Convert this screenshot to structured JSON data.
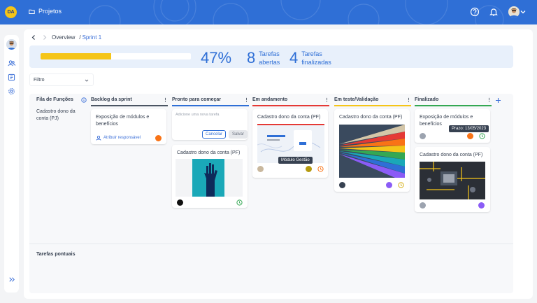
{
  "topbar": {
    "logo_text": "DA",
    "section_label": "Projetos",
    "icons": [
      "help-circle-icon",
      "bell-icon",
      "user-avatar",
      "chevron-down-icon"
    ]
  },
  "breadcrumb": {
    "root": "Overview",
    "separator": "/",
    "current": "Sprint 1"
  },
  "stats": {
    "progress": 0.47,
    "percent_label": "47%",
    "open_count": "8",
    "open_label_1": "Tarefas",
    "open_label_2": "abertas",
    "done_count": "4",
    "done_label_1": "Tarefas",
    "done_label_2": "finalizadas"
  },
  "filter": {
    "label": "Filtro"
  },
  "rows": {
    "queue_title": "Fila de Funções",
    "row1_label": "Cadastro dono da conta (PJ)",
    "row2_label": "Tarefas pontuais"
  },
  "columns": [
    {
      "title": "Backlog da sprint",
      "color": "#4b5563"
    },
    {
      "title": "Pronto para começar",
      "color": "#2f6fd6"
    },
    {
      "title": "Em andamento",
      "color": "#e53935"
    },
    {
      "title": "Em teste/Validação",
      "color": "#f5c518"
    },
    {
      "title": "Finalizado",
      "color": "#34a853"
    }
  ],
  "cards": {
    "backlog_1": {
      "title": "Exposição de módulos e benefícios",
      "assign_label": "Atribuir responsável",
      "dot_color": "#f97316"
    },
    "ready_new": {
      "placeholder": "Adicione uma nova tarefa",
      "cancel": "Cancelar",
      "save": "Salvar"
    },
    "ready_1": {
      "title": "Cadastro dono da conta (PF)"
    },
    "progress_1": {
      "title": "Cadastro dono da conta (PF)",
      "tooltip": "Módulo Gestão",
      "dot_color": "#b59a10"
    },
    "test_1": {
      "title": "Cadastro dono da conta (PF)",
      "dot_color": "#8b5cf6"
    },
    "done_1": {
      "title": "Exposição de módulos e benefícios",
      "tooltip": "Prazo: 13/05/2023",
      "dot_color": "#f97316"
    },
    "done_2": {
      "title": "Cadastro dono da conta (PF)",
      "dot_color": "#8b5cf6"
    }
  }
}
